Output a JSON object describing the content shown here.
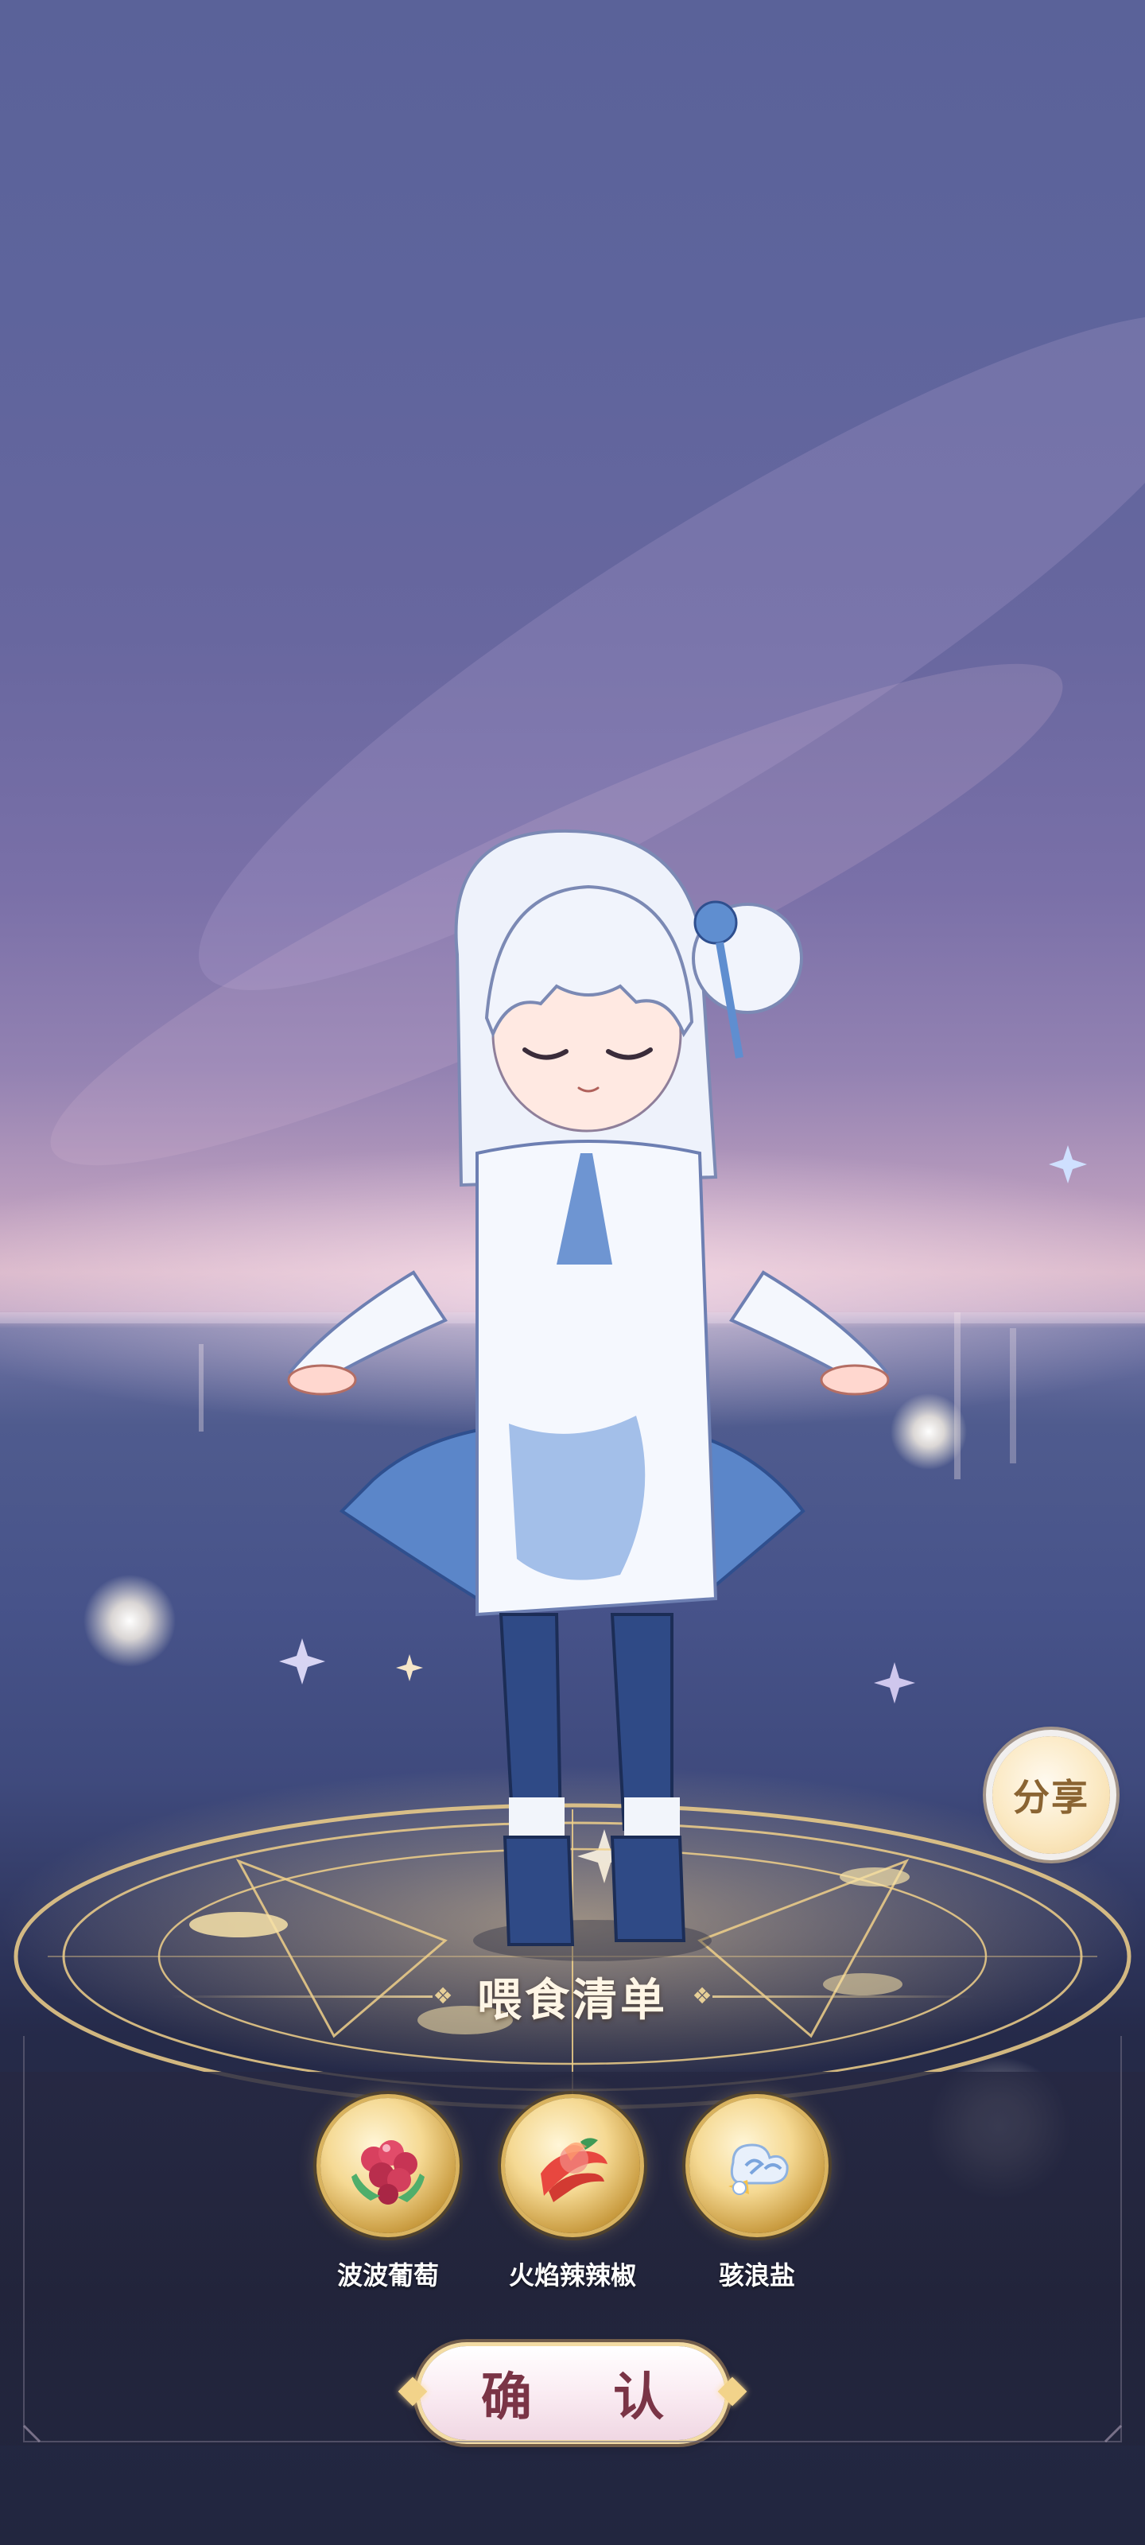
{
  "scene": {
    "character": "chibi-white-haired-girl-blue-dress",
    "background": "night-sky-over-sea",
    "magic_circle_color": "#f0d08a"
  },
  "share": {
    "label": "分享",
    "icon": "share-icon"
  },
  "feed_list": {
    "title": "喂食清单",
    "items": [
      {
        "name": "波波葡萄",
        "icon": "grape-icon"
      },
      {
        "name": "火焰辣辣椒",
        "icon": "chili-pepper-icon"
      },
      {
        "name": "骇浪盐",
        "icon": "wave-salt-icon"
      }
    ]
  },
  "confirm": {
    "label": "确 认"
  },
  "colors": {
    "accent_gold": "#e7cf97",
    "button_text": "#7a3446",
    "title_text": "#fff6e6"
  }
}
